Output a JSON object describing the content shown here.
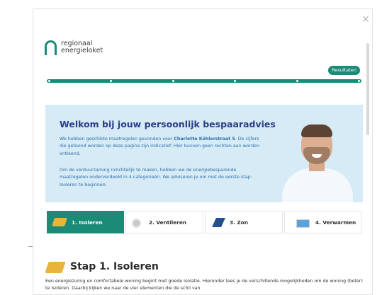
{
  "modal": {
    "close_glyph": "×"
  },
  "logo": {
    "line1": "regionaal",
    "line2": "energieloket"
  },
  "results_button": "Resultaten",
  "progress": {
    "steps": 6,
    "fraction": 1.0
  },
  "welcome": {
    "title": "Welkom bij jouw persoonlijk bespaaradvies",
    "p1_prefix": "We hebben geschikte maatregelen gevonden voor ",
    "address": "Charlotte Köhlerstraat 5",
    "p1_suffix": ". De cijfers die getoond worden op deze pagina zijn indicatief. Hier kunnen geen rechten aan worden ontleend.",
    "p2": "Om de verduurzaming inzichtelijk te maken, hebben we de energiebesparende maatregelen onderverdeeld in 4 categorieën. We adviseren je om met de eerste stap: Isoleren te beginnen."
  },
  "tabs": [
    {
      "label": "1. Isoleren",
      "icon": "insulation-icon",
      "active": true
    },
    {
      "label": "2. Ventileren",
      "icon": "ventilation-icon",
      "active": false
    },
    {
      "label": "3. Zon",
      "icon": "solar-panel-icon",
      "active": false
    },
    {
      "label": "4. Verwarmen",
      "icon": "heating-icon",
      "active": false
    }
  ],
  "section": {
    "title": "Stap 1. Isoleren",
    "intro": "Een energiezuinig en comfortabele woning begint met goede isolatie. Hieronder lees je de verschillende mogelijkheden om de woning (beter) te isoleren. Daarbij kijken we naar de vier elementen die de schil van"
  },
  "colors": {
    "accent": "#1b8a77",
    "welcome_bg": "#d7ebf7",
    "title_blue": "#2a3f86",
    "text_blue": "#2b6fa5"
  }
}
